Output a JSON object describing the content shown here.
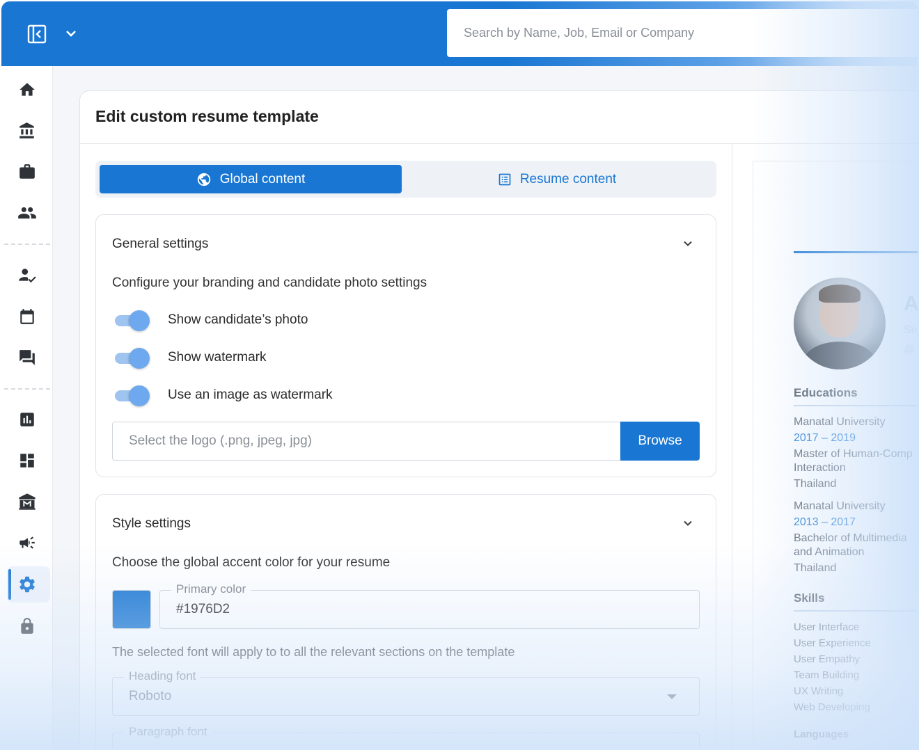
{
  "topbar": {
    "search_placeholder": "Search by Name, Job, Email or Company",
    "panel_toggle_icon": "panel-collapse-icon",
    "menu_icon": "chevron-down-icon",
    "color": "#1976D2"
  },
  "sidebar": {
    "items": [
      {
        "icon": "home-icon"
      },
      {
        "icon": "bank-icon"
      },
      {
        "icon": "briefcase-icon"
      },
      {
        "icon": "people-icon"
      },
      {
        "icon": "person-check-icon"
      },
      {
        "icon": "calendar-icon"
      },
      {
        "icon": "chat-icon"
      },
      {
        "icon": "chart-icon"
      },
      {
        "icon": "dashboard-icon"
      },
      {
        "icon": "museum-m-icon"
      },
      {
        "icon": "campaign-icon"
      },
      {
        "icon": "settings-icon",
        "active": true
      },
      {
        "icon": "lock-icon"
      }
    ]
  },
  "page": {
    "title": "Edit custom resume template"
  },
  "tabs": {
    "global_label": "Global content",
    "resume_label": "Resume content",
    "active": "global"
  },
  "general_settings": {
    "title": "General settings",
    "description": "Configure your branding and candidate photo settings",
    "toggles": [
      {
        "label": "Show candidate’s photo",
        "on": true
      },
      {
        "label": "Show watermark",
        "on": true
      },
      {
        "label": "Use an image as watermark",
        "on": true
      }
    ],
    "logo_placeholder": "Select the logo (.png, jpeg, jpg)",
    "browse_label": "Browse"
  },
  "style_settings": {
    "title": "Style settings",
    "accent_description": "Choose the global accent color for your resume",
    "primary_color_label": "Primary color",
    "primary_color_value": "#1976D2",
    "font_description": "The selected font will apply to to all the relevant sections on the template",
    "heading_font_label": "Heading font",
    "heading_font_value": "Roboto",
    "paragraph_font_label": "Paragraph font"
  },
  "preview": {
    "name_initial": "A",
    "subline_1": "Se",
    "subline_2": "@",
    "educations_title": "Educations",
    "educations": [
      {
        "school": "Manatal University",
        "years": "2017 – 2019",
        "degree_1": "Master of Human-Comp",
        "degree_2": "Interaction",
        "country": "Thailand"
      },
      {
        "school": "Manatal University",
        "years": "2013 – 2017",
        "degree_1": "Bachelor of Multimedia",
        "degree_2": "and Animation",
        "country": "Thailand"
      }
    ],
    "skills_title": "Skills",
    "skills": [
      "User Interface",
      "User Experience",
      "User Empathy",
      "Team Building",
      "UX Writing",
      "Web Developing"
    ],
    "languages_title": "Languages"
  }
}
